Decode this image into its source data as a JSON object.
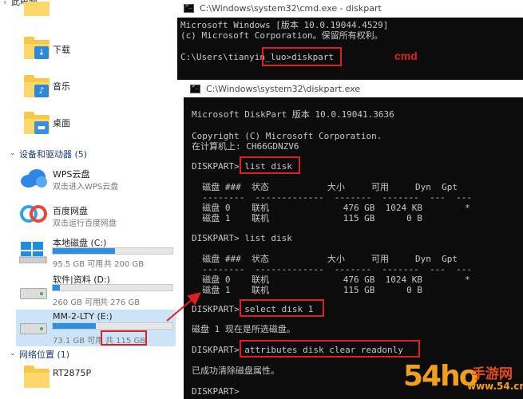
{
  "explorer": {
    "pc_label": "此电脑",
    "folders": [
      {
        "name": "下载"
      },
      {
        "name": "音乐"
      },
      {
        "name": "桌面"
      }
    ],
    "devices_group": "设备和驱动器 (5)",
    "cloud": [
      {
        "name": "WPS云盘",
        "sub": "双击进入WPS云盘"
      },
      {
        "name": "百度网盘",
        "sub": "双击运行百度网盘"
      }
    ],
    "drives": [
      {
        "name": "本地磁盘 (C:)",
        "free": "95.5 GB 可用",
        "total": "共 200 GB",
        "used_fraction": 0.52
      },
      {
        "name": "软件|资料 (D:)",
        "free": "260 GB 可用",
        "total": "共 276 GB",
        "used_fraction": 0.06
      },
      {
        "name": "MM-2-LTY (E:)",
        "free": "73.1 GB 可用",
        "total": "共 115 GB",
        "used_fraction": 0.36
      }
    ],
    "network_group": "网络位置 (1)",
    "network_items": [
      {
        "name": "RT2875P"
      }
    ]
  },
  "cmd": {
    "title": "C:\\Windows\\system32\\cmd.exe - diskpart",
    "line1": "Microsoft Windows [版本 10.0.19044.4529]",
    "line2": "(c) Microsoft Corporation。保留所有权利。",
    "prompt": "C:\\Users\\tianyin_luo>",
    "command": "diskpart",
    "annotation": "cmd"
  },
  "diskpart": {
    "title": "C:\\Windows\\system32\\diskpart.exe",
    "line_version": "Microsoft DiskPart 版本 10.0.19041.3636",
    "line_copyright": "Copyright (C) Microsoft Corporation.",
    "line_machine": "在计算机上: CH66GDNZV6",
    "prompt": "DISKPART> ",
    "cmd_list": "list disk",
    "table_header": "  磁盘 ###  状态           大小     可用     Dyn  Gpt",
    "table_sep": "  --------  -------------  -------  -------  ---  ---",
    "table_row0": "  磁盘 0    联机              476 GB  1024 KB        *",
    "table_row1": "  磁盘 1    联机              115 GB      0 B",
    "table2_header": "  磁盘 ###  状态           大小     可用     Dyn  Gpt",
    "table2_sep": "  --------  -------------  -------  -------  ---  ---",
    "table2_row0": "  磁盘 0    联机              476 GB  1024 KB        *",
    "table2_row1": "  磁盘 1    联机              115 GB      0 B",
    "cmd_select": "select disk 1",
    "msg_selected": "磁盘 1 现在是所选磁盘。",
    "cmd_attr": "attributes disk clear readonly",
    "msg_cleared": "已成功清除磁盘属性。"
  },
  "watermark": {
    "number": "54",
    "glyph": "ho",
    "name": "手游网",
    "url": "www.54.cn"
  },
  "colors": {
    "annotation_red": "#e02020",
    "terminal_bg": "#0c0c0c",
    "terminal_text": "#c8c8c8",
    "drive_fill": "#2f8ee0",
    "watermark_orange": "#f2a01c"
  }
}
